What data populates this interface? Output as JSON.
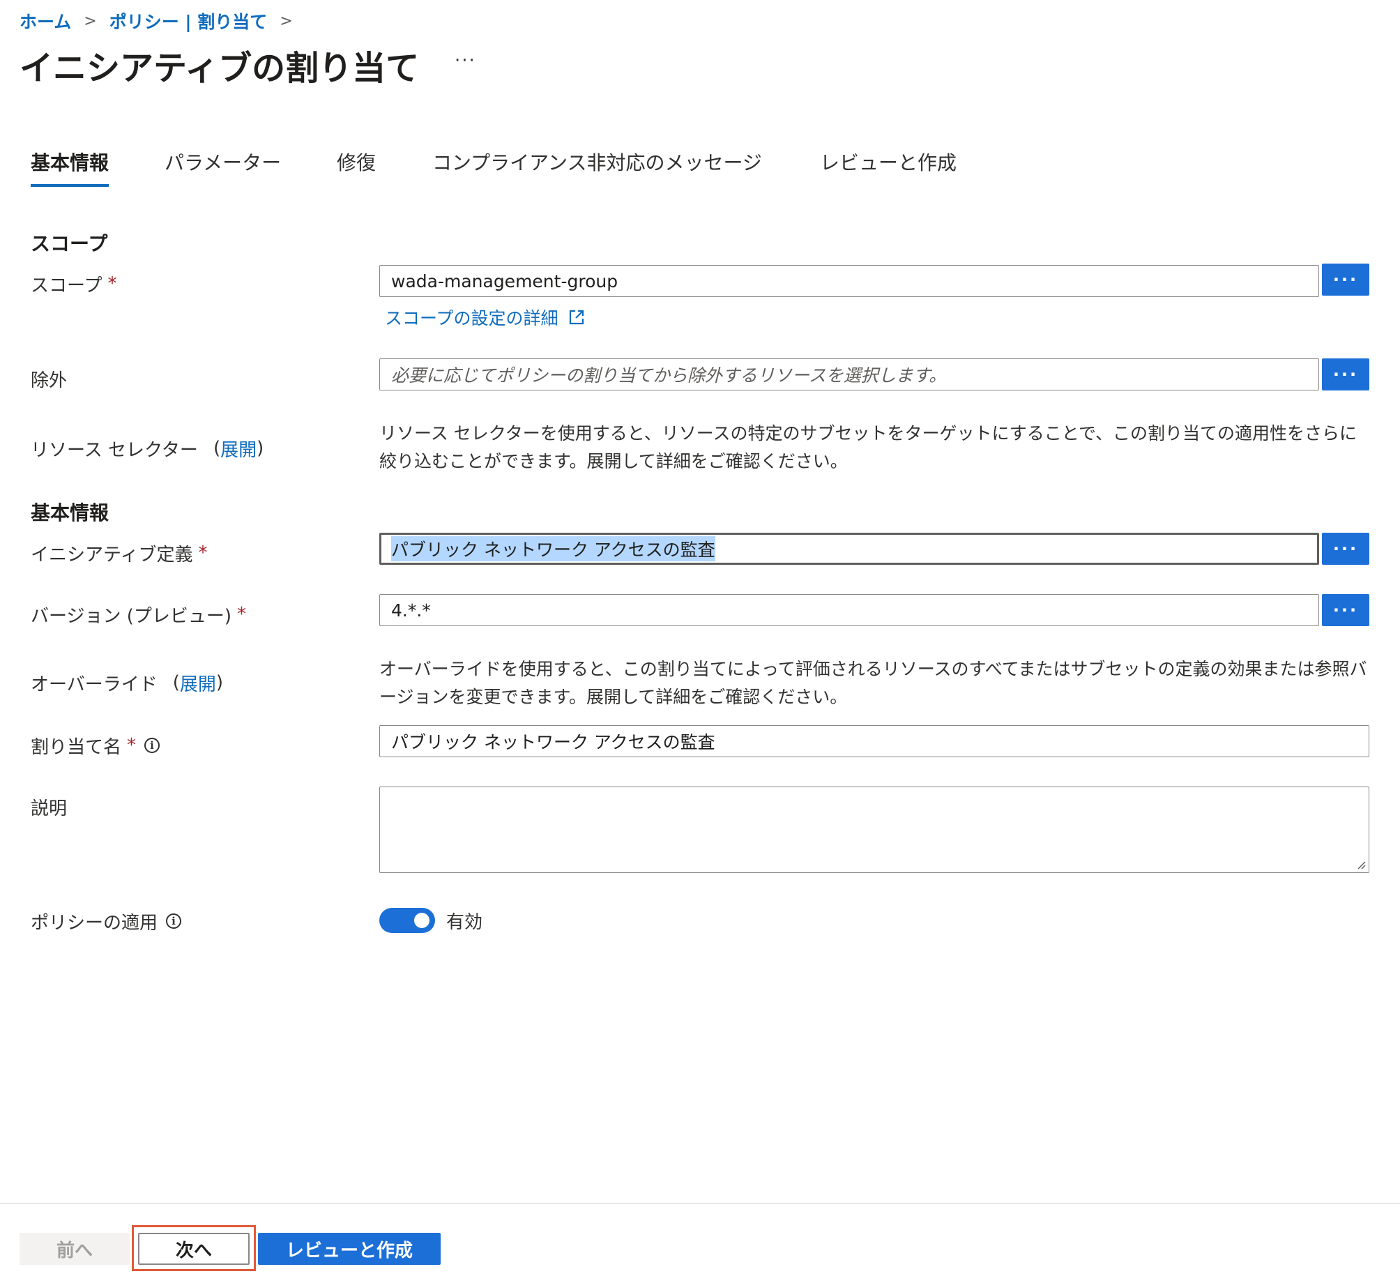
{
  "breadcrumb": {
    "items": [
      "ホーム",
      "ポリシー | 割り当て"
    ],
    "separator": ">"
  },
  "page": {
    "title": "イニシアティブの割り当て",
    "more": "···"
  },
  "tabs": [
    {
      "label": "基本情報",
      "active": true
    },
    {
      "label": "パラメーター",
      "active": false
    },
    {
      "label": "修復",
      "active": false
    },
    {
      "label": "コンプライアンス非対応のメッセージ",
      "active": false
    },
    {
      "label": "レビューと作成",
      "active": false
    }
  ],
  "scope_section": {
    "heading": "スコープ",
    "scope_label": "スコープ",
    "required_mark": "*",
    "scope_value": "wada-management-group",
    "scope_link": "スコープの設定の詳細",
    "exclusions_label": "除外",
    "exclusions_placeholder": "必要に応じてポリシーの割り当てから除外するリソースを選択します。",
    "resource_selector_label": "リソース セレクター",
    "resource_selector_paren_open": "(",
    "resource_selector_expand": "展開",
    "resource_selector_paren_close": ")",
    "resource_selector_desc": "リソース セレクターを使用すると、リソースの特定のサブセットをターゲットにすることで、この割り当ての適用性をさらに絞り込むことができます。展開して詳細をご確認ください。"
  },
  "basics_section": {
    "heading": "基本情報",
    "initiative_label": "イニシアティブ定義",
    "initiative_value": "パブリック ネットワーク アクセスの監査",
    "version_label": "バージョン (プレビュー)",
    "version_value": "4.*.*",
    "overrides_label": "オーバーライド",
    "overrides_paren_open": "(",
    "overrides_expand": "展開",
    "overrides_paren_close": ")",
    "overrides_desc": "オーバーライドを使用すると、この割り当てによって評価されるリソースのすべてまたはサブセットの定義の効果または参照バージョンを変更できます。展開して詳細をご確認ください。",
    "assignment_name_label": "割り当て名",
    "assignment_name_value": "パブリック ネットワーク アクセスの監査",
    "description_label": "説明",
    "description_value": "",
    "enforcement_label": "ポリシーの適用",
    "enforcement_value": "有効",
    "enforcement_enabled": true
  },
  "icons": {
    "info": "i",
    "dots": "···"
  },
  "footer": {
    "prev_label": "前へ",
    "next_label": "次へ",
    "review_label": "レビューと作成"
  },
  "colors": {
    "accent": "#1d6fd8",
    "link": "#0f6cbd",
    "required": "#a4262c",
    "highlight": "#e05a3a"
  }
}
